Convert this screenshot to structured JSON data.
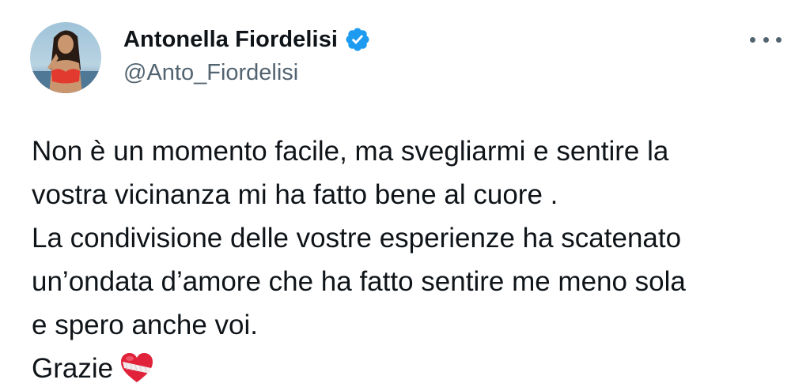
{
  "author": {
    "display_name": "Antonella Fiordelisi",
    "handle": "@Anto_Fiordelisi",
    "verified_icon": "verified-badge-icon",
    "avatar_icon": "profile-photo"
  },
  "menu": {
    "icon": "more-options-icon"
  },
  "tweet": {
    "lines": [
      "Non è un momento facile, ma svegliarmi e sentire la",
      "vostra vicinanza mi ha fatto bene al cuore .",
      "La condivisione delle vostre esperienze ha scatenato",
      "un’ondata d’amore che ha fatto sentire me meno sola",
      "e spero anche voi.",
      "Grazie"
    ],
    "emoji": "mending-heart-icon"
  },
  "colors": {
    "text": "#0f1419",
    "secondary": "#536471",
    "verified_blue": "#1d9bf0",
    "heart_red": "#e0233a"
  }
}
